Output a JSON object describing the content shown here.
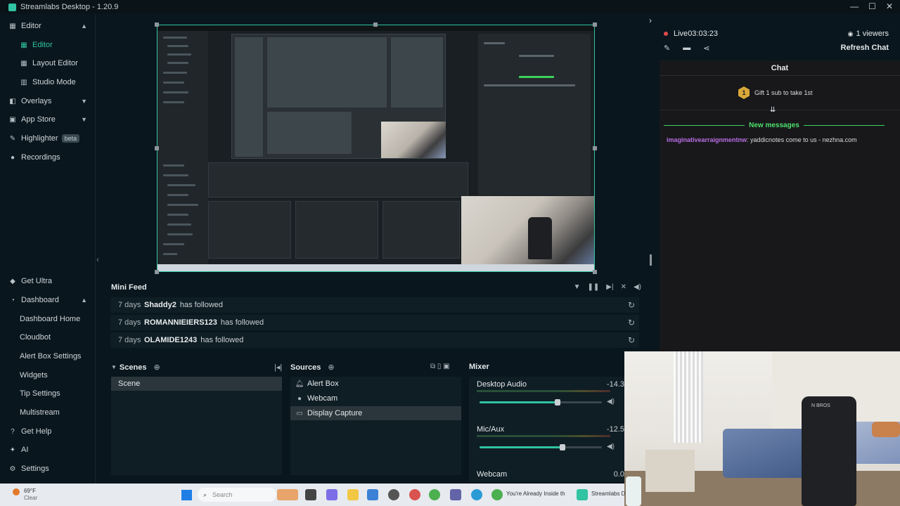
{
  "app": {
    "title": "Streamlabs Desktop - 1.20.9"
  },
  "window_controls": {
    "minimize": "—",
    "maximize": "☐",
    "close": "✕"
  },
  "nav": {
    "editor": "Editor",
    "editor_sub": [
      "Editor",
      "Layout Editor",
      "Studio Mode"
    ],
    "overlays": "Overlays",
    "app_store": "App Store",
    "highlighter": "Highlighter",
    "highlighter_badge": "beta",
    "recordings": "Recordings",
    "get_ultra": "Get Ultra",
    "dashboard": "Dashboard",
    "dashboard_sub": [
      "Dashboard Home",
      "Cloudbot",
      "Alert Box Settings",
      "Widgets",
      "Tip Settings",
      "Multistream"
    ],
    "get_help": "Get Help",
    "ai": "AI",
    "settings": "Settings"
  },
  "mini_feed": {
    "title": "Mini Feed",
    "events": [
      {
        "age": "7 days",
        "user": "Shaddy2",
        "action": "has followed"
      },
      {
        "age": "7 days",
        "user": "ROMANNIEIERS123",
        "action": "has followed"
      },
      {
        "age": "7 days",
        "user": "OLAMIDE1243",
        "action": "has followed"
      }
    ]
  },
  "scenes": {
    "title": "Scenes",
    "items": [
      "Scene"
    ]
  },
  "sources": {
    "title": "Sources",
    "items": [
      {
        "name": "Alert Box",
        "icon": "bell-icon"
      },
      {
        "name": "Webcam",
        "icon": "camera-icon"
      },
      {
        "name": "Display Capture",
        "icon": "monitor-icon",
        "selected": true
      }
    ]
  },
  "mixer": {
    "title": "Mixer",
    "channels": [
      {
        "name": "Desktop Audio",
        "db": "-14.3",
        "level": 0.64
      },
      {
        "name": "Mic/Aux",
        "db": "-12.5",
        "level": 0.68
      },
      {
        "name": "Webcam",
        "db": "0.0"
      }
    ]
  },
  "stream": {
    "live_label": "Live",
    "live_time": "03:03:23",
    "viewers": "1 viewers",
    "refresh_chat": "Refresh Chat"
  },
  "chat": {
    "header": "Chat",
    "gift_badge": "1",
    "gift_text": "Gift 1 sub to take 1st",
    "new_messages": "New messages",
    "messages": [
      {
        "user": "imaginativearraignmentnw",
        "text": ": yaddicnotes come to us - nezhna.com"
      }
    ]
  },
  "webcam": {
    "chair_logo": "N BROS"
  },
  "taskbar": {
    "weather_temp": "69°F",
    "weather_cond": "Clear",
    "search_placeholder": "Search",
    "task1": "You're Already Inside th",
    "task2": "Streamlabs D"
  },
  "colors": {
    "accent": "#31c3a2",
    "live": "#e14b4b",
    "new_messages": "#4ee06c",
    "chat_user": "#b86ee4"
  }
}
